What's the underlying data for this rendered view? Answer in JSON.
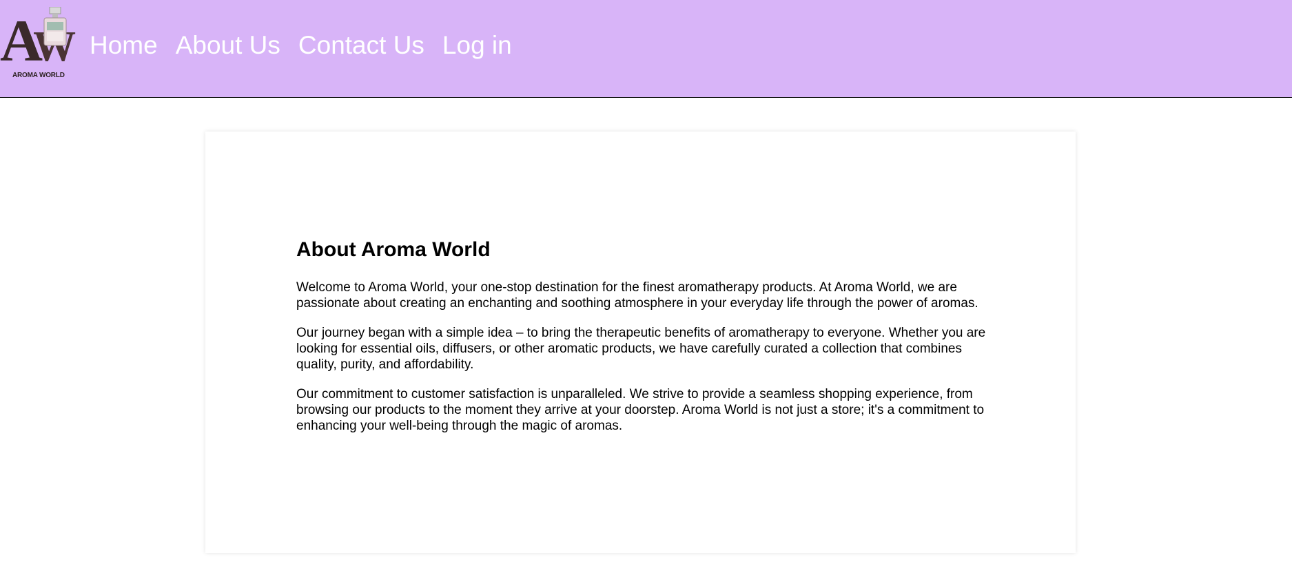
{
  "header": {
    "logo": {
      "letters_a": "A",
      "letters_w": "W",
      "subtitle": "AROMA WORLD"
    },
    "nav": [
      {
        "label": "Home"
      },
      {
        "label": "About Us"
      },
      {
        "label": "Contact Us"
      },
      {
        "label": "Log in"
      }
    ]
  },
  "about": {
    "title": "About Aroma World",
    "paragraphs": [
      "Welcome to Aroma World, your one-stop destination for the finest aromatherapy products. At Aroma World, we are passionate about creating an enchanting and soothing atmosphere in your everyday life through the power of aromas.",
      "Our journey began with a simple idea – to bring the therapeutic benefits of aromatherapy to everyone. Whether you are looking for essential oils, diffusers, or other aromatic products, we have carefully curated a collection that combines quality, purity, and affordability.",
      "Our commitment to customer satisfaction is unparalleled. We strive to provide a seamless shopping experience, from browsing our products to the moment they arrive at your doorstep. Aroma World is not just a store; it's a commitment to enhancing your well-being through the magic of aromas."
    ]
  },
  "colors": {
    "header_bg": "#d8b4f8",
    "nav_text": "#ffffff",
    "page_bg": "#ffffff",
    "logo_text": "#3a2a2a"
  }
}
